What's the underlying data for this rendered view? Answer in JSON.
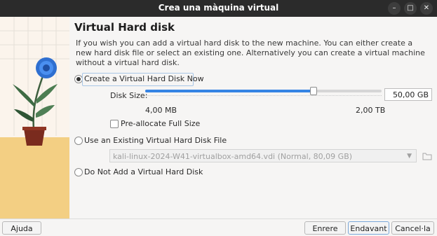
{
  "window": {
    "title": "Crea una màquina virtual",
    "minimize": "–",
    "maximize": "□",
    "close": "✕"
  },
  "page": {
    "heading": "Virtual Hard disk",
    "description": "If you wish you can add a virtual hard disk to the new machine. You can either create a new hard disk file or select an existing one. Alternatively you can create a virtual machine without a virtual hard disk."
  },
  "options": {
    "create_now": {
      "label": "Create a Virtual Hard Disk Now",
      "selected": true
    },
    "use_existing": {
      "label": "Use an Existing Virtual Hard Disk File",
      "selected": false
    },
    "none": {
      "label": "Do Not Add a Virtual Hard Disk",
      "selected": false
    }
  },
  "disk": {
    "size_label": "Disk Size:",
    "size_value": "50,00 GB",
    "slider_min": "4,00 MB",
    "slider_max": "2,00 TB",
    "slider_fraction": 0.71,
    "prealloc_label": "Pre-allocate Full Size",
    "prealloc_checked": false
  },
  "existing": {
    "file": "kali-linux-2024-W41-virtualbox-amd64.vdi (Normal, 80,09 GB)"
  },
  "buttons": {
    "help": "Ajuda",
    "back": "Enrere",
    "next": "Endavant",
    "cancel": "Cancel·la"
  },
  "colors": {
    "accent": "#3584e4",
    "titlebar": "#2b2b2b",
    "sand": "#f3cf83"
  }
}
